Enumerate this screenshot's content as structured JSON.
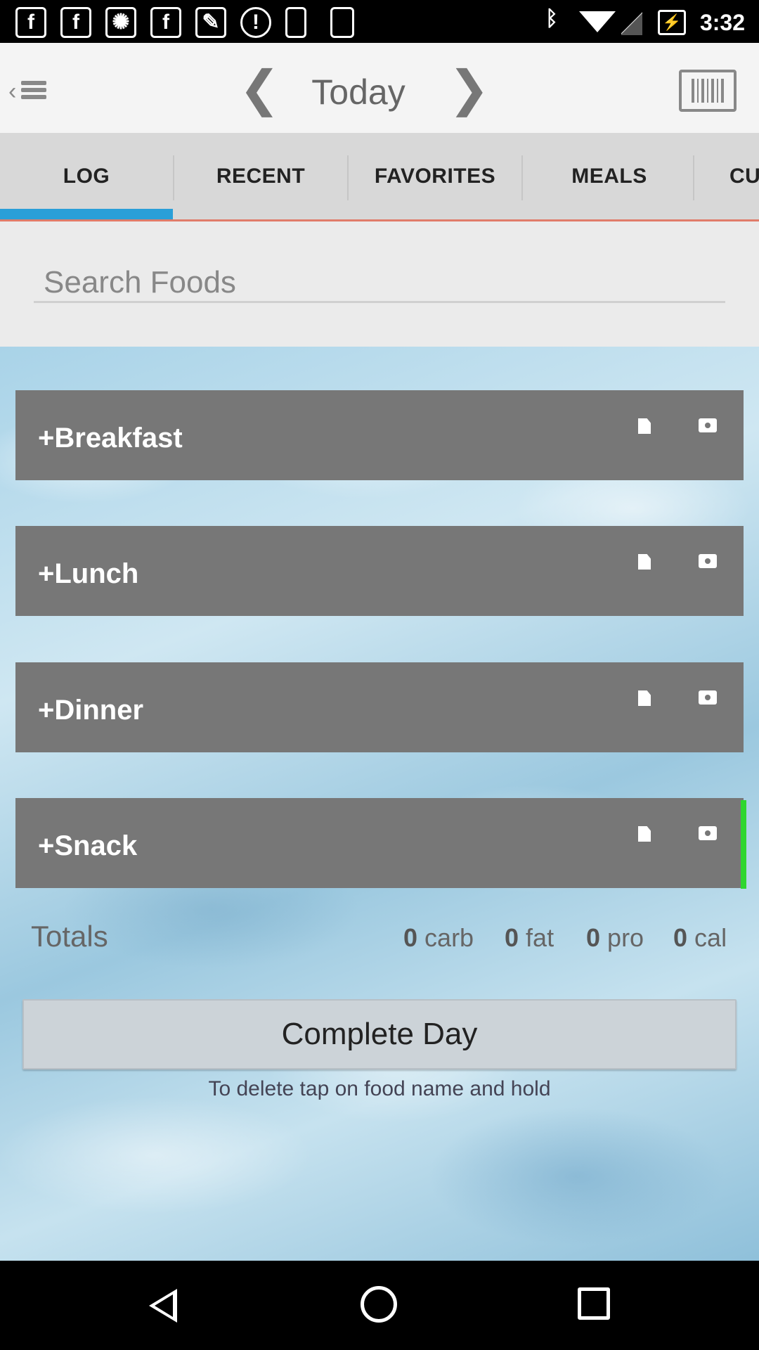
{
  "status_bar": {
    "notification_icons": [
      "facebook-icon",
      "facebook-icon",
      "aperture-icon",
      "facebook-icon",
      "tools-icon",
      "info-icon",
      "lock-icon",
      "phone-icon"
    ],
    "right_icons": [
      "bluetooth-icon",
      "wifi-icon",
      "no-signal-icon",
      "battery-charging-icon"
    ],
    "time": "3:32"
  },
  "header": {
    "title": "Today",
    "prev_arrow": "❮",
    "next_arrow": "❯"
  },
  "tabs": [
    {
      "label": "LOG",
      "selected": true
    },
    {
      "label": "RECENT"
    },
    {
      "label": "FAVORITES"
    },
    {
      "label": "MEALS"
    },
    {
      "label": "CU"
    }
  ],
  "search": {
    "placeholder": "Search Foods"
  },
  "meals": [
    {
      "label": "+Breakfast"
    },
    {
      "label": "+Lunch"
    },
    {
      "label": "+Dinner"
    },
    {
      "label": "+Snack"
    }
  ],
  "totals": {
    "label": "Totals",
    "carb_value": "0",
    "carb_unit": "carb",
    "fat_value": "0",
    "fat_unit": "fat",
    "pro_value": "0",
    "pro_unit": "pro",
    "cal_value": "0",
    "cal_unit": "cal"
  },
  "complete_button": "Complete Day",
  "hint": "To delete tap on food name and hold",
  "colors": {
    "accent": "#2a9fd8",
    "meal_bar": "#777777",
    "tab_underline": "#e07c6a"
  }
}
